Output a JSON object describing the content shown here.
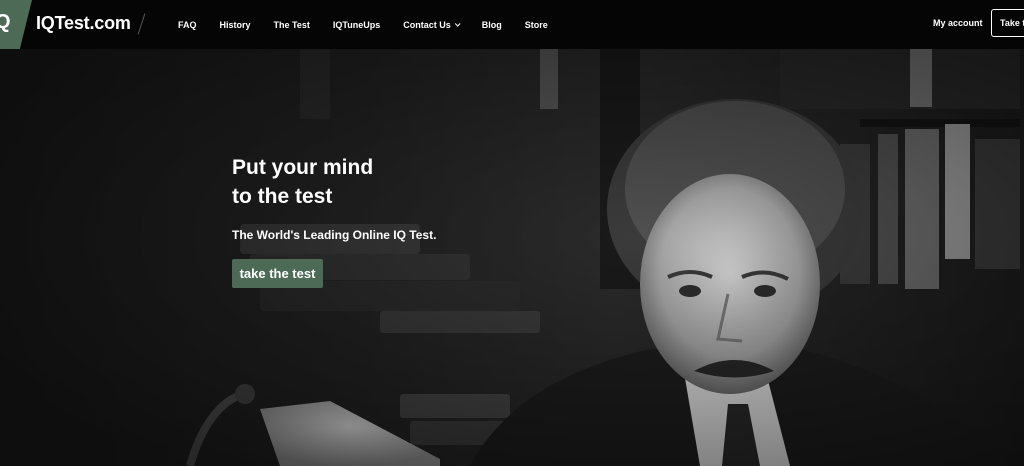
{
  "brand": {
    "logo_mark": "Q",
    "name": "IQTest.com",
    "accent": "#4c6a55"
  },
  "nav": {
    "items": [
      {
        "label": "FAQ"
      },
      {
        "label": "History"
      },
      {
        "label": "The Test"
      },
      {
        "label": "IQTuneUps"
      },
      {
        "label": "Contact Us",
        "has_dropdown": true
      },
      {
        "label": "Blog"
      },
      {
        "label": "Store"
      }
    ],
    "account_label": "My account",
    "cta_label": "Take the test"
  },
  "hero": {
    "headline_line1": "Put your mind",
    "headline_line2": "to the test",
    "tagline": "The World's Leading Online IQ Test.",
    "cta_label": "take the test"
  }
}
